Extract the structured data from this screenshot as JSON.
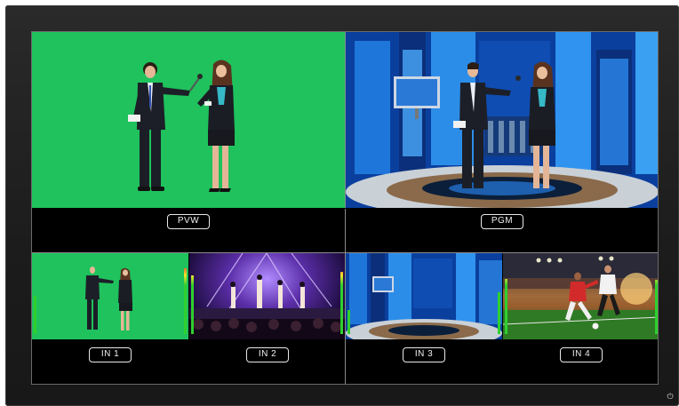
{
  "multiview": {
    "pvw": {
      "label": "PVW"
    },
    "pgm": {
      "label": "PGM"
    },
    "inputs": [
      {
        "label": "IN 1",
        "meter_left": 0.55,
        "meter_right": 0.95
      },
      {
        "label": "IN 2",
        "meter_left": 0.85,
        "meter_right": 0.9
      },
      {
        "label": "IN 3",
        "meter_left": 0.35,
        "meter_right": 0.6
      },
      {
        "label": "IN 4",
        "meter_left": 0.8,
        "meter_right": 0.78
      }
    ]
  },
  "colors": {
    "chroma_green": "#1fc25c",
    "meter_green": "#2fd02f",
    "meter_yellow": "#f2e42a",
    "meter_red": "#e23a2a",
    "label_border": "#e8e8e8"
  },
  "icons": {
    "power": "power-icon"
  }
}
